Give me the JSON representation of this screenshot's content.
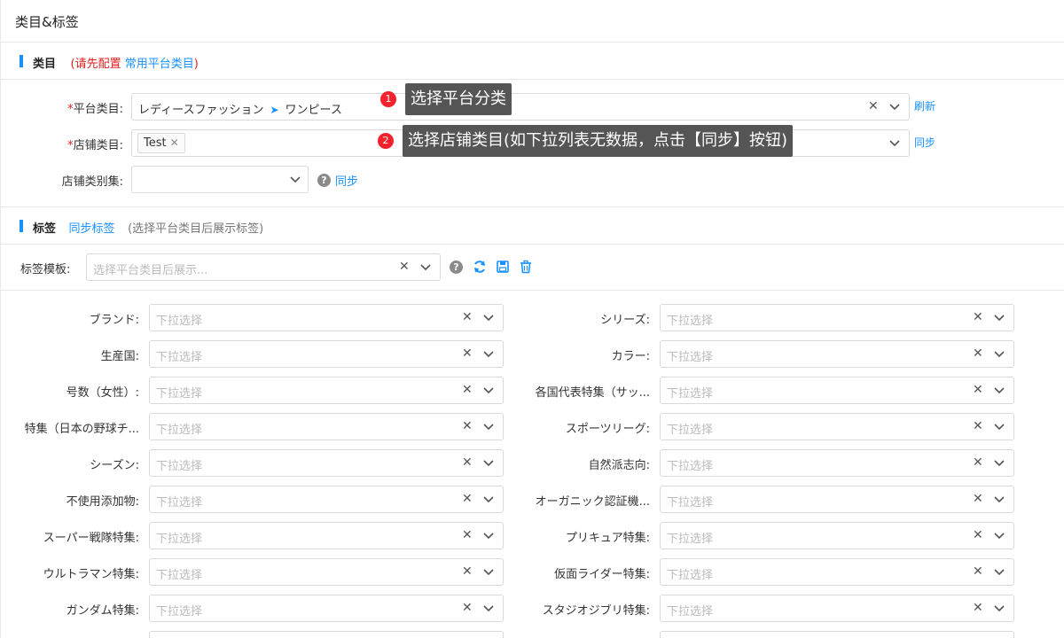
{
  "page": {
    "title": "类目&标签"
  },
  "category_section": {
    "title": "类目",
    "note_prefix": "(请先配置 ",
    "note_link": "常用平台类目",
    "note_suffix": ")"
  },
  "platform_category": {
    "label": "平台类目:",
    "path_1": "レディースファッション",
    "path_2": "ワンピース",
    "refresh_label": "刷新"
  },
  "shop_category": {
    "label": "店铺类目:",
    "tag": "Test",
    "sync_label": "同步"
  },
  "shop_category_set": {
    "label": "店铺类别集:",
    "sync_label": "同步"
  },
  "callouts": [
    {
      "num": "1",
      "text": "选择平台分类"
    },
    {
      "num": "2",
      "text": "选择店铺类目(如下拉列表无数据，点击【同步】按钮)"
    }
  ],
  "tags_section": {
    "title": "标签",
    "sync_link": "同步标签",
    "hint": "(选择平台类目后展示标签)"
  },
  "tag_template": {
    "label": "标签模板:",
    "placeholder": "选择平台类目后展示..."
  },
  "attributes": {
    "placeholder": "下拉选择",
    "left": [
      "ブランド:",
      "生産国:",
      "号数（女性）:",
      "特集（日本の野球チ...",
      "シーズン:",
      "不使用添加物:",
      "スーパー戦隊特集:",
      "ウルトラマン特集:",
      "ガンダム特集:"
    ],
    "right": [
      "シリーズ:",
      "カラー:",
      "各国代表特集（サッ...",
      "スポーツリーグ:",
      "自然派志向:",
      "オーガニック認証機...",
      "プリキュア特集:",
      "仮面ライダー特集:",
      "スタジオジブリ特集:"
    ]
  },
  "colors": {
    "accent": "#1890ff",
    "required": "#e02020",
    "callout_bg": "#555555",
    "callout_num": "#f5222d"
  }
}
